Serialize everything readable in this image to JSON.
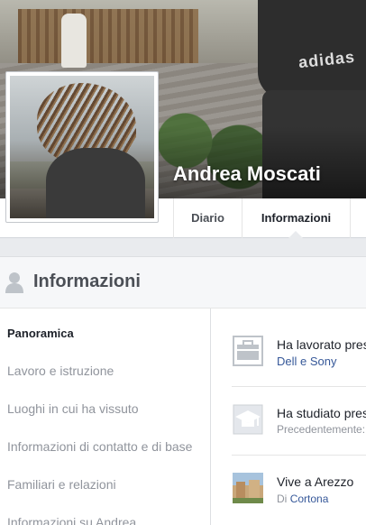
{
  "profile": {
    "name": "Andrea Moscati",
    "cover_text": "adidas"
  },
  "tabs": [
    {
      "label": "Diario"
    },
    {
      "label": "Informazioni"
    }
  ],
  "section": {
    "title": "Informazioni"
  },
  "leftnav": [
    {
      "label": "Panoramica"
    },
    {
      "label": "Lavoro e istruzione"
    },
    {
      "label": "Luoghi in cui ha vissuto"
    },
    {
      "label": "Informazioni di contatto e di base"
    },
    {
      "label": "Familiari e relazioni"
    },
    {
      "label": "Informazioni su Andrea"
    }
  ],
  "overview": {
    "work": {
      "line1": "Ha lavorato pres",
      "line2": "Dell e Sony"
    },
    "study": {
      "line1": "Ha studiato pres",
      "line2": "Precedentemente:"
    },
    "live": {
      "line1": "Vive a Arezzo",
      "line2_prefix": "Di",
      "line2_link": "Cortona"
    }
  },
  "colors": {
    "link": "#365899",
    "muted": "#90949c",
    "text": "#1d2129"
  }
}
